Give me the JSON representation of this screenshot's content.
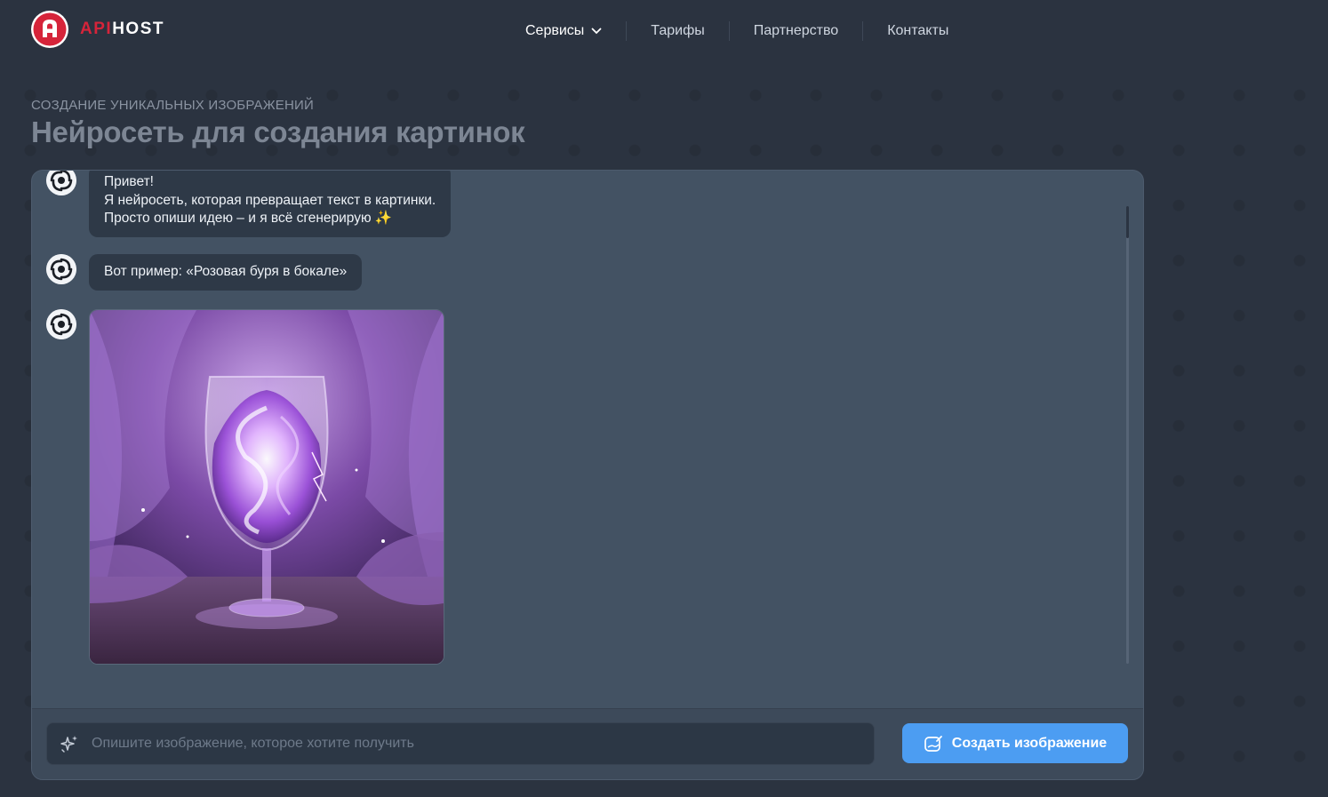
{
  "header": {
    "logo_text_accent": "API",
    "logo_text_main": "HOST",
    "nav": [
      {
        "label": "Сервисы"
      },
      {
        "label": "Тарифы"
      },
      {
        "label": "Партнерство"
      },
      {
        "label": "Контакты"
      }
    ]
  },
  "hero": {
    "kicker": "СОЗДАНИЕ УНИКАЛЬНЫХ ИЗОБРАЖЕНИЙ",
    "title": "Нейросеть для создания картинок"
  },
  "chat": {
    "messages": [
      {
        "lines": [
          "Привет!",
          "Я нейросеть, которая превращает текст в картинки.",
          "Просто опиши идею – и я всё сгенерирую ✨"
        ]
      },
      {
        "lines": [
          "Вот пример: «Розовая буря в бокале»"
        ]
      },
      {
        "type": "image",
        "image_subject": "glass-with-purple-storm"
      }
    ]
  },
  "composer": {
    "placeholder": "Опишите изображение, которое хотите получить",
    "value": "",
    "button_label": "Создать изображение"
  },
  "colors": {
    "page_bg": "#2b3340",
    "panel_bg": "#435263",
    "bubble_bg": "#2e3947",
    "brand_red": "#d6243a",
    "button_blue": "#4c9df2"
  }
}
